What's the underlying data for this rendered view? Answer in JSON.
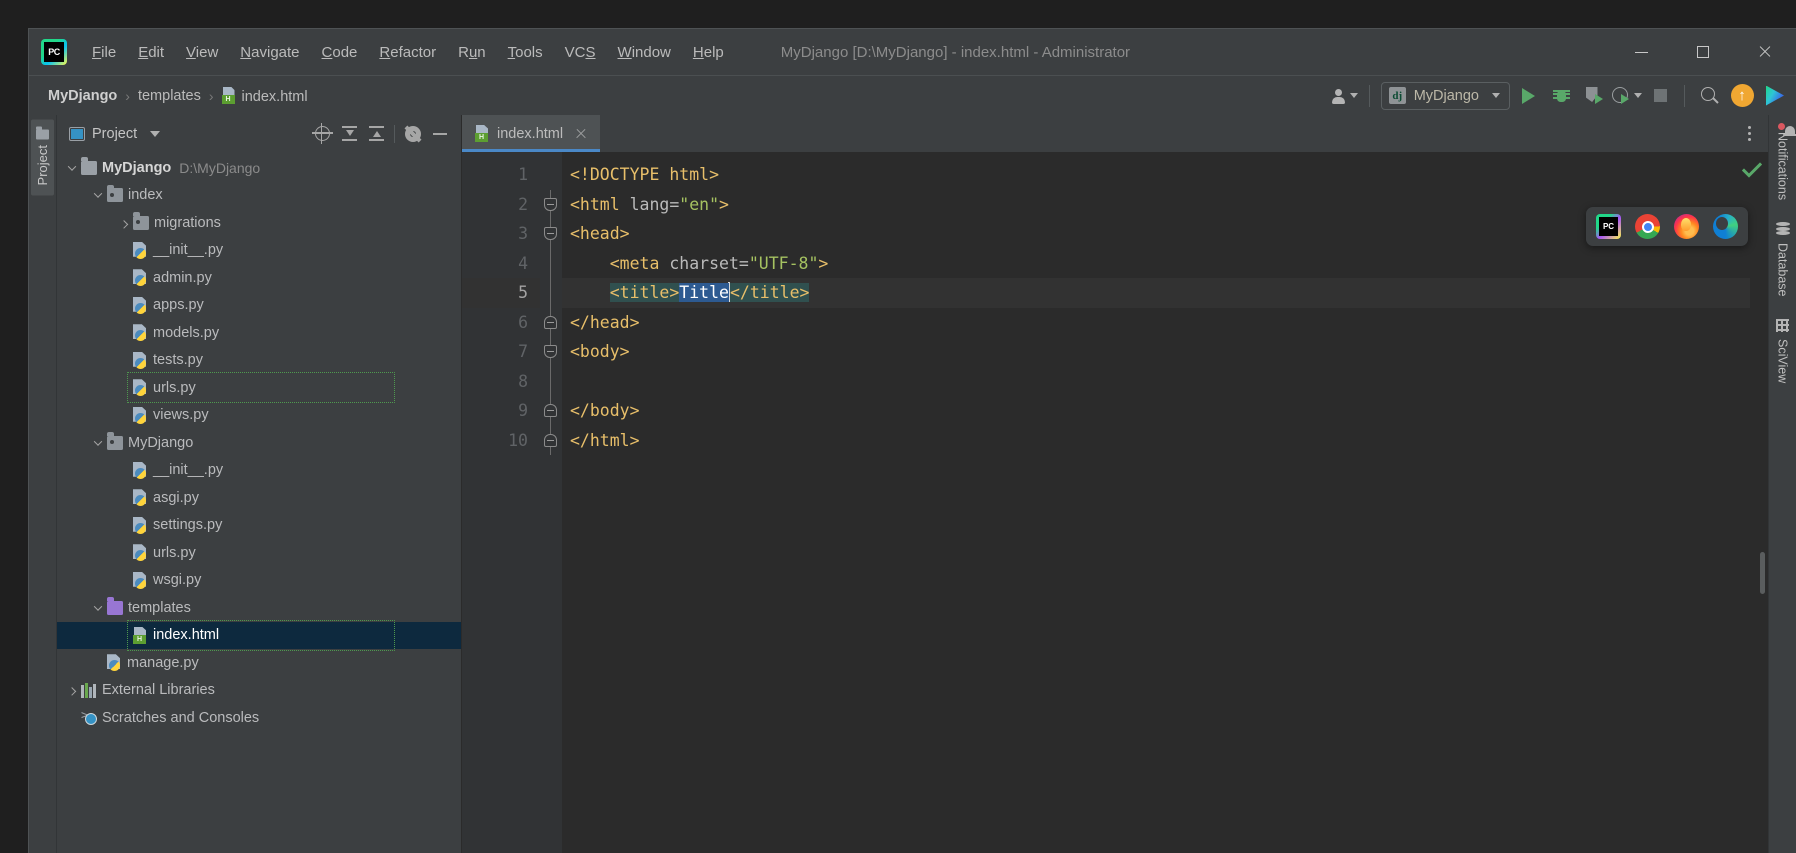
{
  "window": {
    "title": "MyDjango [D:\\MyDjango] - index.html - Administrator",
    "minimize_label": "Minimize",
    "maximize_label": "Maximize",
    "close_label": "Close"
  },
  "menu": {
    "items": [
      {
        "pre": "",
        "mn": "F",
        "post": "ile"
      },
      {
        "pre": "",
        "mn": "E",
        "post": "dit"
      },
      {
        "pre": "",
        "mn": "V",
        "post": "iew"
      },
      {
        "pre": "",
        "mn": "N",
        "post": "avigate"
      },
      {
        "pre": "",
        "mn": "C",
        "post": "ode"
      },
      {
        "pre": "",
        "mn": "R",
        "post": "efactor"
      },
      {
        "pre": "R",
        "mn": "u",
        "post": "n"
      },
      {
        "pre": "",
        "mn": "T",
        "post": "ools"
      },
      {
        "pre": "VC",
        "mn": "S",
        "post": ""
      },
      {
        "pre": "",
        "mn": "W",
        "post": "indow"
      },
      {
        "pre": "",
        "mn": "H",
        "post": "elp"
      }
    ]
  },
  "breadcrumb": {
    "project": "MyDjango",
    "folder": "templates",
    "file": "index.html",
    "sep": "›"
  },
  "toolbar": {
    "run_config": "MyDjango",
    "run_config_badge": "dj",
    "run_label": "Run",
    "debug_label": "Debug",
    "coverage_label": "Run with Coverage",
    "profile_label": "Profile",
    "stop_label": "Stop",
    "search_label": "Search Everywhere",
    "update_label": "Update Project",
    "datasphere_label": "DataSpell"
  },
  "project_panel": {
    "strip_tab": "Project",
    "title": "Project",
    "locate_label": "Select Opened File",
    "expand_label": "Expand All",
    "collapse_label": "Collapse All",
    "settings_label": "Settings",
    "hide_label": "Hide",
    "tree": [
      {
        "label": "MyDjango",
        "path": "D:\\MyDjango",
        "icon": "folder-plain",
        "indent": 0,
        "arrow": "down",
        "bold": true
      },
      {
        "label": "index",
        "path": "",
        "icon": "folder-module",
        "indent": 1,
        "arrow": "down",
        "bold": false
      },
      {
        "label": "migrations",
        "path": "",
        "icon": "folder-module",
        "indent": 2,
        "arrow": "right",
        "bold": false
      },
      {
        "label": "__init__.py",
        "path": "",
        "icon": "python",
        "indent": 2,
        "arrow": "none",
        "bold": false
      },
      {
        "label": "admin.py",
        "path": "",
        "icon": "python",
        "indent": 2,
        "arrow": "none",
        "bold": false
      },
      {
        "label": "apps.py",
        "path": "",
        "icon": "python",
        "indent": 2,
        "arrow": "none",
        "bold": false
      },
      {
        "label": "models.py",
        "path": "",
        "icon": "python",
        "indent": 2,
        "arrow": "none",
        "bold": false
      },
      {
        "label": "tests.py",
        "path": "",
        "icon": "python",
        "indent": 2,
        "arrow": "none",
        "bold": false
      },
      {
        "label": "urls.py",
        "path": "",
        "icon": "python",
        "indent": 2,
        "arrow": "none",
        "bold": false,
        "highlight": true
      },
      {
        "label": "views.py",
        "path": "",
        "icon": "python",
        "indent": 2,
        "arrow": "none",
        "bold": false
      },
      {
        "label": "MyDjango",
        "path": "",
        "icon": "folder-module",
        "indent": 1,
        "arrow": "down",
        "bold": false
      },
      {
        "label": "__init__.py",
        "path": "",
        "icon": "python",
        "indent": 2,
        "arrow": "none",
        "bold": false
      },
      {
        "label": "asgi.py",
        "path": "",
        "icon": "python",
        "indent": 2,
        "arrow": "none",
        "bold": false
      },
      {
        "label": "settings.py",
        "path": "",
        "icon": "python",
        "indent": 2,
        "arrow": "none",
        "bold": false
      },
      {
        "label": "urls.py",
        "path": "",
        "icon": "python",
        "indent": 2,
        "arrow": "none",
        "bold": false
      },
      {
        "label": "wsgi.py",
        "path": "",
        "icon": "python",
        "indent": 2,
        "arrow": "none",
        "bold": false
      },
      {
        "label": "templates",
        "path": "",
        "icon": "folder-purple",
        "indent": 1,
        "arrow": "down",
        "bold": false
      },
      {
        "label": "index.html",
        "path": "",
        "icon": "html",
        "indent": 2,
        "arrow": "none",
        "bold": false,
        "selected": true,
        "highlight": true
      },
      {
        "label": "manage.py",
        "path": "",
        "icon": "python",
        "indent": 1,
        "arrow": "none",
        "bold": false
      },
      {
        "label": "External Libraries",
        "path": "",
        "icon": "library",
        "indent": 0,
        "arrow": "right",
        "bold": false
      },
      {
        "label": "Scratches and Consoles",
        "path": "",
        "icon": "scratches",
        "indent": 0,
        "arrow": "none",
        "bold": false
      }
    ]
  },
  "editor": {
    "tab": {
      "label": "index.html",
      "close_label": "Close tab"
    },
    "options_label": "Editor options",
    "inspection_status": "OK",
    "lines": [
      {
        "num": "1",
        "fold": "none",
        "current": false,
        "parts": [
          {
            "t": "tag",
            "s": "<!DOCTYPE html>"
          }
        ]
      },
      {
        "num": "2",
        "fold": "open",
        "current": false,
        "parts": [
          {
            "t": "tag",
            "s": "<html "
          },
          {
            "t": "attr",
            "s": "lang="
          },
          {
            "t": "val",
            "s": "\"en\""
          },
          {
            "t": "tag",
            "s": ">"
          }
        ]
      },
      {
        "num": "3",
        "fold": "open",
        "current": false,
        "parts": [
          {
            "t": "tag",
            "s": "<head>"
          }
        ]
      },
      {
        "num": "4",
        "fold": "line",
        "current": false,
        "parts": [
          {
            "t": "plain",
            "s": "    "
          },
          {
            "t": "tag",
            "s": "<meta "
          },
          {
            "t": "attr",
            "s": "charset="
          },
          {
            "t": "val",
            "s": "\"UTF-8\""
          },
          {
            "t": "tag",
            "s": ">"
          }
        ]
      },
      {
        "num": "5",
        "fold": "line",
        "current": true,
        "parts": [
          {
            "t": "plain",
            "s": "    "
          },
          {
            "t": "selstart",
            "s": ""
          },
          {
            "t": "tag",
            "s": "<title>"
          },
          {
            "t": "selblue",
            "s": "Title"
          },
          {
            "t": "caret",
            "s": ""
          },
          {
            "t": "tag",
            "s": "</title>"
          },
          {
            "t": "selend",
            "s": ""
          }
        ]
      },
      {
        "num": "6",
        "fold": "close",
        "current": false,
        "parts": [
          {
            "t": "tag",
            "s": "</head>"
          }
        ]
      },
      {
        "num": "7",
        "fold": "open",
        "current": false,
        "parts": [
          {
            "t": "tag",
            "s": "<body>"
          }
        ]
      },
      {
        "num": "8",
        "fold": "line",
        "current": false,
        "parts": [
          {
            "t": "plain",
            "s": ""
          }
        ]
      },
      {
        "num": "9",
        "fold": "close",
        "current": false,
        "parts": [
          {
            "t": "tag",
            "s": "</body>"
          }
        ]
      },
      {
        "num": "10",
        "fold": "close",
        "current": false,
        "parts": [
          {
            "t": "tag",
            "s": "</html>"
          }
        ]
      }
    ],
    "selected_text": "Title",
    "browser_popup": [
      {
        "name": "pycharm-browser-icon",
        "label": "PyCharm built-in preview"
      },
      {
        "name": "chrome-icon",
        "label": "Chrome"
      },
      {
        "name": "firefox-icon",
        "label": "Firefox"
      },
      {
        "name": "edge-icon",
        "label": "Edge"
      }
    ]
  },
  "right_strip": {
    "tabs": [
      {
        "label": "Notifications",
        "icon": "bell-icon",
        "badge": true
      },
      {
        "label": "Database",
        "icon": "database-icon",
        "badge": false
      },
      {
        "label": "SciView",
        "icon": "sciview-icon",
        "badge": false
      }
    ]
  },
  "colors": {
    "accent_blue": "#4a88c7",
    "selection_blue": "#2d5a91",
    "selection_teal": "#30504f",
    "tree_selection": "#0d293e",
    "highlight_green": "#4f9a4f",
    "panel_bg": "#3c3f41",
    "editor_bg": "#2b2b2b",
    "gutter_bg": "#313335",
    "tag_color": "#e8bf6a",
    "string_color": "#a5c261",
    "text_color": "#a9b7c6"
  }
}
